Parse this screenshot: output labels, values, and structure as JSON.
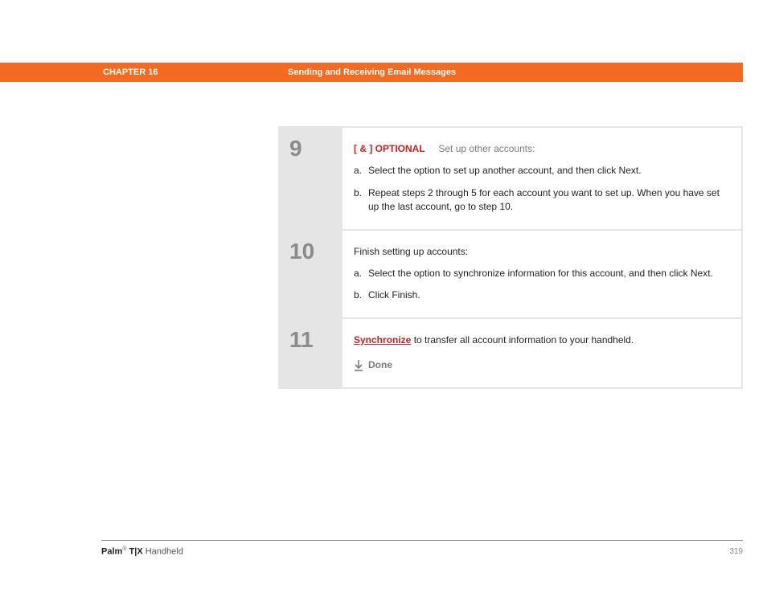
{
  "header": {
    "chapter": "CHAPTER 16",
    "title": "Sending and Receiving Email Messages"
  },
  "steps": [
    {
      "number": "9",
      "optional_prefix": "[ & ]",
      "optional_label": "OPTIONAL",
      "optional_rest": "Set up other accounts:",
      "items": [
        {
          "marker": "a.",
          "text": "Select the option to set up another account, and then click Next."
        },
        {
          "marker": "b.",
          "text": "Repeat steps 2 through 5 for each account you want to set up. When you have set up the last account, go to step 10."
        }
      ]
    },
    {
      "number": "10",
      "intro": "Finish setting up accounts:",
      "items": [
        {
          "marker": "a.",
          "text": "Select the option to synchronize information for this account, and then click Next."
        },
        {
          "marker": "b.",
          "text": "Click Finish."
        }
      ]
    },
    {
      "number": "11",
      "sync_link": "Synchronize",
      "sync_rest": " to transfer all account information to your handheld.",
      "done_label": "Done"
    }
  ],
  "footer": {
    "brand": "Palm",
    "reg": "®",
    "model": " T|X",
    "product_rest": " Handheld",
    "page": "319"
  }
}
